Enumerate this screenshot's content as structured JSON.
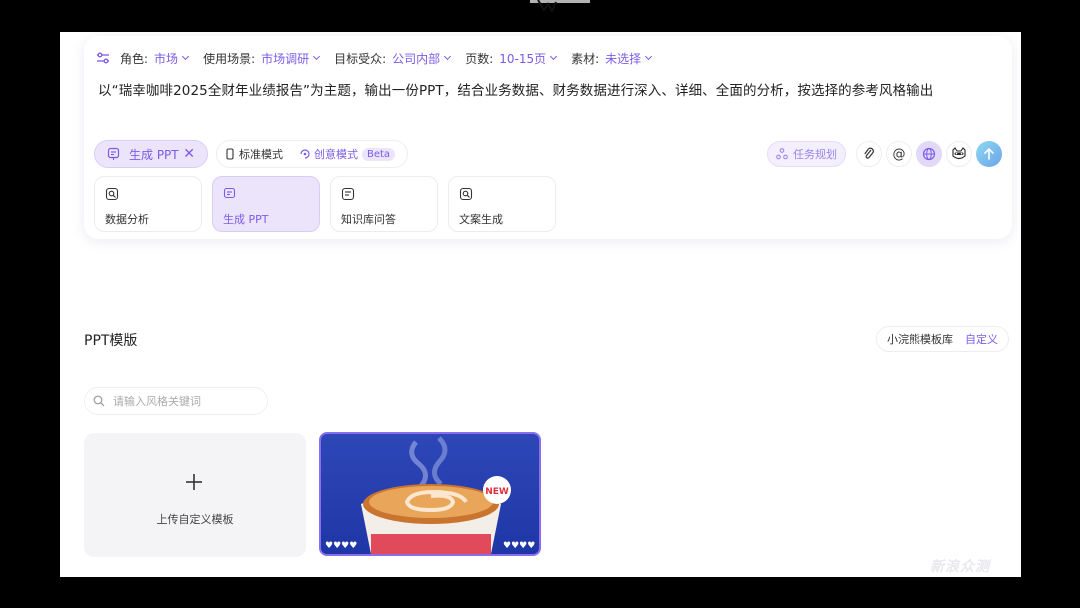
{
  "params": [
    {
      "label": "角色:",
      "value": "市场"
    },
    {
      "label": "使用场景:",
      "value": "市场调研"
    },
    {
      "label": "目标受众:",
      "value": "公司内部"
    },
    {
      "label": "页数:",
      "value": "10-15页"
    },
    {
      "label": "素材:",
      "value": "未选择"
    }
  ],
  "prompt": "以“瑞幸咖啡2025全财年业绩报告”为主题，输出一份PPT，结合业务数据、财务数据进行深入、详细、全面的分析，按选择的参考风格输出",
  "chip": {
    "label": "生成 PPT"
  },
  "modes": {
    "standard": "标准模式",
    "creative": "创意模式",
    "beta": "Beta"
  },
  "task_planning": "任务规划",
  "tools": [
    {
      "label": "数据分析"
    },
    {
      "label": "生成 PPT"
    },
    {
      "label": "知识库问答"
    },
    {
      "label": "文案生成"
    }
  ],
  "section_title": "PPT模版",
  "template_tabs": {
    "library": "小浣熊模板库",
    "custom": "自定义"
  },
  "search": {
    "placeholder": "请输入风格关键词"
  },
  "upload_label": "上传自定义模板",
  "thumb_badge": "NEW",
  "watermark": "新浪众测",
  "colors": {
    "accent": "#7b5ce6",
    "accent_bg": "#ebe4fb",
    "thumb_blue": "#2e47b8"
  }
}
